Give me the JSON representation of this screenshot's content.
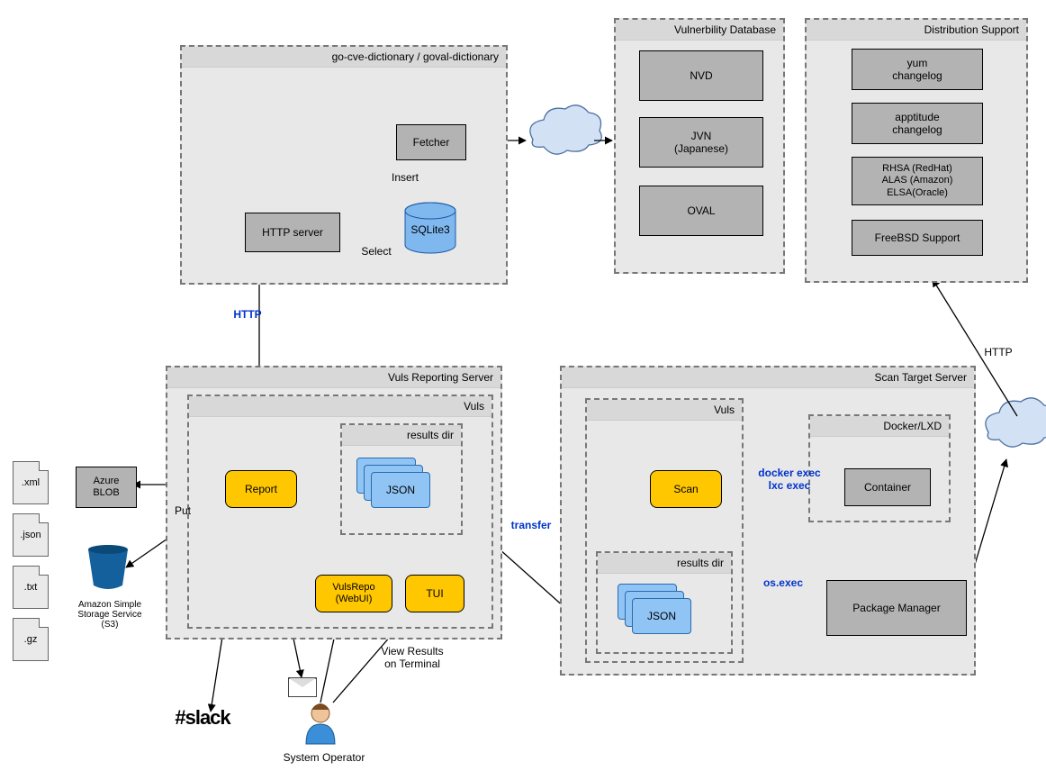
{
  "groups": {
    "dict": "go-cve-dictionary / goval-dictionary",
    "vulndb": "Vulnerbility Database",
    "distsupport": "Distribution Support",
    "reporting": "Vuls Reporting Server",
    "vuls_rep": "Vuls",
    "resultsdir_rep": "results dir",
    "scantarget": "Scan Target Server",
    "vuls_scan": "Vuls",
    "resultsdir_scan": "results dir",
    "dockerlxd": "Docker/LXD"
  },
  "nodes": {
    "fetcher": "Fetcher",
    "httpserver": "HTTP server",
    "sqlite": "SQLite3",
    "nvd": "NVD",
    "jvn": "JVN\n(Japanese)",
    "oval": "OVAL",
    "yum": "yum\nchangelog",
    "apptitude": "apptitude\nchangelog",
    "rhsa": "RHSA (RedHat)\nALAS (Amazon)\nELSA(Oracle)",
    "freebsd": "FreeBSD Support",
    "azure": "Azure\nBLOB",
    "report": "Report",
    "json_rep": "JSON",
    "vulsrepo": "VulsRepo\n(WebUI)",
    "tui": "TUI",
    "scan": "Scan",
    "json_scan": "JSON",
    "container": "Container",
    "pkgmgr": "Package Manager"
  },
  "labels": {
    "insert": "Insert",
    "select": "Select",
    "http": "HTTP",
    "http_caps": "HTTP",
    "put": "Put",
    "transfer": "transfer",
    "dockerexec": "docker exec\nlxc exec",
    "osexec": "os.exec",
    "viewresults": "View Results\non Terminal",
    "s3": "Amazon Simple\nStorage Service\n(S3)",
    "sysop": "System Operator",
    "slack": "slack"
  },
  "files": {
    "xml": ".xml",
    "json": ".json",
    "txt": ".txt",
    "gz": ".gz"
  }
}
